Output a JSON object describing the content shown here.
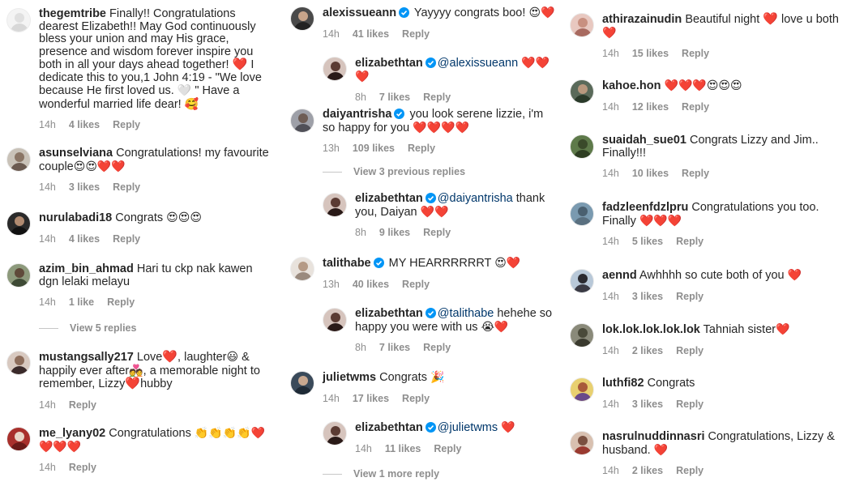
{
  "colors": {
    "heart": "#ed1c24",
    "verified": "#0095f6",
    "muted": "#8e8e8e",
    "mention": "#00376b"
  },
  "column1": [
    {
      "username": "thegemtribe",
      "pre": " Finally!! Congratulations dearest Elizabeth!! May God continuously bless your union and may His grace, presence and wisdom forever inspire you both in all your days ahead together! ",
      "mid": " I dedicate this to you,1 John 4:19 - \"We love because He first loved us. ",
      "post": " \" Have a wonderful married life dear! ",
      "trail": "🥰",
      "time": "14h",
      "likes": "4 likes",
      "reply": "Reply"
    },
    {
      "username": "asunselviana",
      "text": " Congratulations! my favourite couple",
      "emoji": "😍😍❤️❤️",
      "time": "14h",
      "likes": "3 likes",
      "reply": "Reply"
    },
    {
      "username": "nurulabadi18",
      "text": " Congrats ",
      "emoji": "😍😍😍",
      "time": "14h",
      "likes": "4 likes",
      "reply": "Reply"
    },
    {
      "username": "azim_bin_ahmad",
      "text": " Hari tu ckp nak kawen dgn lelaki melayu",
      "time": "14h",
      "likes": "1 like",
      "reply": "Reply",
      "view": "View 5 replies"
    },
    {
      "username": "mustangsally217",
      "text": " Love",
      "t2": ", laughter",
      "t3": " & happily ever after",
      "t4": ", a memorable night to remember, Lizzy",
      "t5": "hubby",
      "time": "14h",
      "reply": "Reply"
    },
    {
      "username": "me_lyany02",
      "text": " Congratulations ",
      "emoji": "👏👏👏👏❤️❤️❤️❤️",
      "time": "14h",
      "reply": "Reply"
    }
  ],
  "column2": [
    {
      "username": "alexissueann",
      "text": " Yayyyy congrats boo! ",
      "emoji": "😍❤️",
      "time": "14h",
      "likes": "41 likes",
      "reply": "Reply"
    },
    {
      "username": "elizabethtan",
      "mention": "@alexissueann",
      "text": " ",
      "emoji": "❤️❤️❤️",
      "time": "8h",
      "likes": "7 likes",
      "reply": "Reply"
    },
    {
      "username": "daiyantrisha",
      "text": " you look serene lizzie, i'm so happy for you ",
      "emoji": "❤️❤️❤️❤️",
      "time": "13h",
      "likes": "109 likes",
      "reply": "Reply",
      "view": "View 3 previous replies"
    },
    {
      "username": "elizabethtan",
      "mention": "@daiyantrisha",
      "text": " thank you, Daiyan ",
      "emoji": "❤️❤️",
      "time": "8h",
      "likes": "9 likes",
      "reply": "Reply"
    },
    {
      "username": "talithabe",
      "text": " MY HEARRRRRRT ",
      "emoji": "😍❤️",
      "time": "13h",
      "likes": "40 likes",
      "reply": "Reply"
    },
    {
      "username": "elizabethtan",
      "mention": "@talithabe",
      "text": " hehehe so happy you were with us ",
      "emoji": "😭❤️",
      "time": "8h",
      "likes": "7 likes",
      "reply": "Reply"
    },
    {
      "username": "julietwms",
      "text": " Congrats ",
      "emoji": "🎉",
      "time": "14h",
      "likes": "17 likes",
      "reply": "Reply"
    },
    {
      "username": "elizabethtan",
      "mention": "@julietwms",
      "text": " ",
      "emoji": "❤️",
      "time": "14h",
      "likes": "11 likes",
      "reply": "Reply",
      "view": "View 1 more reply"
    }
  ],
  "column3": [
    {
      "username": "athirazainudin",
      "text": " Beautiful night ",
      "t2": " love u both ",
      "emoji": "❤️",
      "time": "14h",
      "likes": "15 likes",
      "reply": "Reply"
    },
    {
      "username": "kahoe.hon",
      "text": " ",
      "emoji": "❤️❤️❤️😍😍😍",
      "time": "14h",
      "likes": "12 likes",
      "reply": "Reply"
    },
    {
      "username": "suaidah_sue01",
      "text": " Congrats Lizzy and Jim.. Finally!!!",
      "time": "14h",
      "likes": "10 likes",
      "reply": "Reply"
    },
    {
      "username": "fadzleenfdzlpru",
      "text": " Congratulations you too. Finally ",
      "emoji": "❤️❤️❤️",
      "time": "14h",
      "likes": "5 likes",
      "reply": "Reply"
    },
    {
      "username": "aennd",
      "text": " Awhhhh so cute both of you ",
      "emoji": "❤️",
      "time": "14h",
      "likes": "3 likes",
      "reply": "Reply"
    },
    {
      "username": "lok.lok.lok.lok.lok",
      "text": " Tahniah sister",
      "emoji": "❤️",
      "time": "14h",
      "likes": "2 likes",
      "reply": "Reply"
    },
    {
      "username": "luthfi82",
      "text": " Congrats",
      "time": "14h",
      "likes": "3 likes",
      "reply": "Reply"
    },
    {
      "username": "nasrulnuddinnasri",
      "text": " Congratulations, Lizzy & husband. ",
      "emoji": "❤️",
      "time": "14h",
      "likes": "2 likes",
      "reply": "Reply"
    }
  ]
}
